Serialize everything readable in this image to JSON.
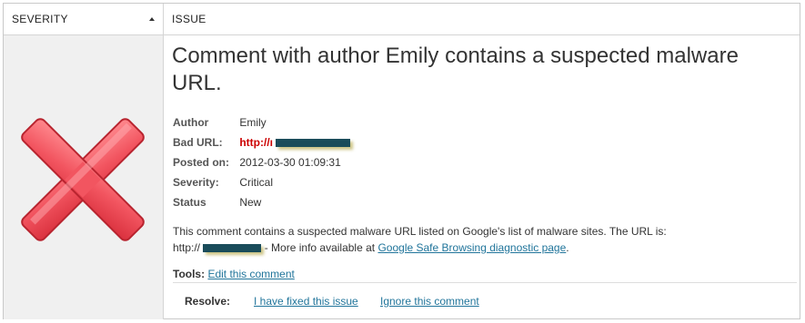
{
  "table": {
    "headers": {
      "severity": "SEVERITY",
      "issue": "ISSUE"
    }
  },
  "severity_icon": "red-x-critical-icon",
  "issue": {
    "title": "Comment with author Emily contains a suspected malware URL.",
    "meta": [
      {
        "label": "Author",
        "value": "Emily"
      },
      {
        "label": "Bad URL:",
        "value": "http://ı"
      },
      {
        "label": "Posted on:",
        "value": "2012-03-30 01:09:31"
      },
      {
        "label": "Severity:",
        "value": "Critical"
      },
      {
        "label": "Status",
        "value": "New"
      }
    ],
    "description": {
      "text": "This comment contains a suspected malware URL listed on Google's list of malware sites. The URL is:",
      "url_prefix": "http://",
      "more_info": "- More info available at",
      "link": "Google Safe Browsing diagnostic page",
      "period": "."
    },
    "tools": {
      "label": "Tools:",
      "edit_link": "Edit this comment"
    },
    "resolve": {
      "label": "Resolve:",
      "fixed_link": "I have fixed this issue",
      "ignore_link": "Ignore this comment"
    }
  },
  "colors": {
    "link": "#21759b",
    "bad_url": "#cc0000",
    "redaction": "#1a4c5a"
  }
}
